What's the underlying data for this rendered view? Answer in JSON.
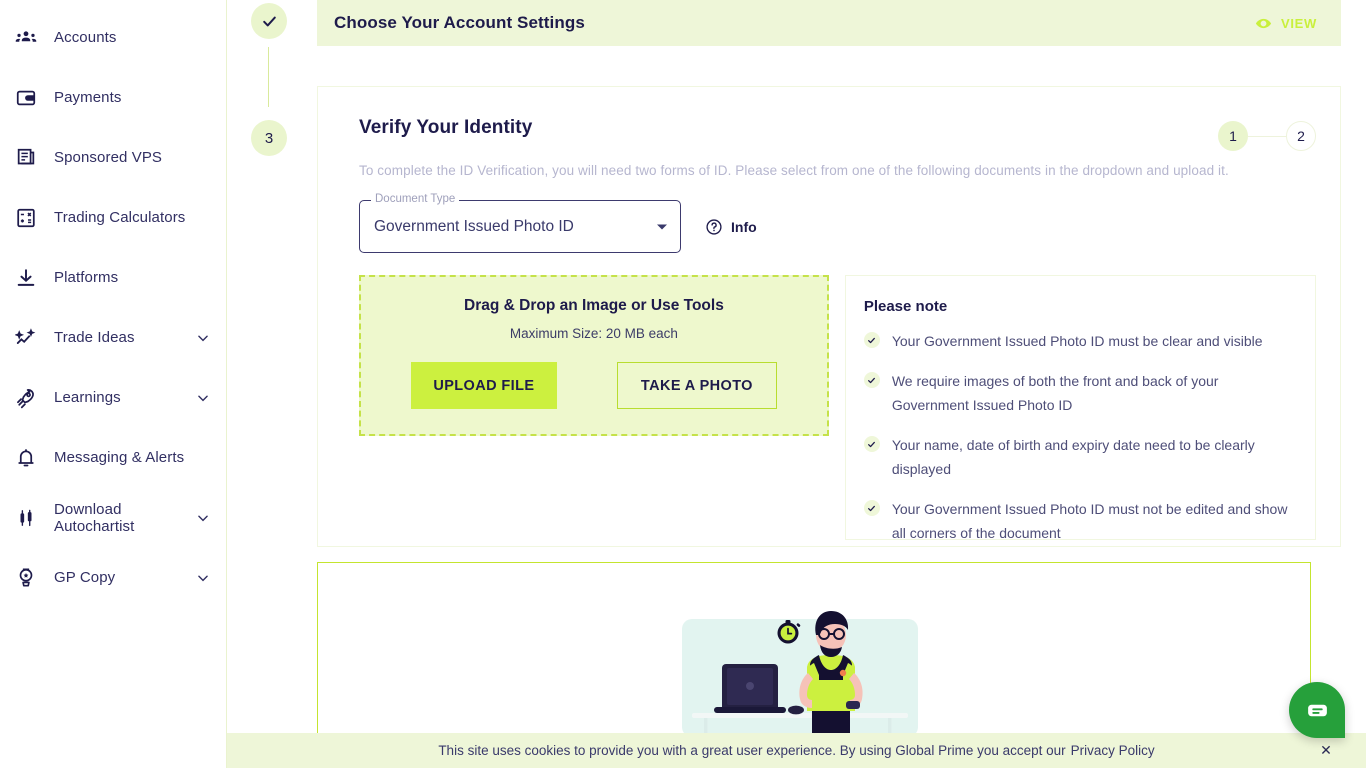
{
  "sidebar": {
    "items": [
      {
        "label": "Accounts",
        "icon": "people-icon",
        "chevron": false
      },
      {
        "label": "Payments",
        "icon": "wallet-icon",
        "chevron": false
      },
      {
        "label": "Sponsored VPS",
        "icon": "server-icon",
        "chevron": false
      },
      {
        "label": "Trading Calculators",
        "icon": "calculator-icon",
        "chevron": false
      },
      {
        "label": "Platforms",
        "icon": "download-icon",
        "chevron": false
      },
      {
        "label": "Trade Ideas",
        "icon": "sparkle-chart-icon",
        "chevron": true
      },
      {
        "label": "Learnings",
        "icon": "rocket-icon",
        "chevron": true
      },
      {
        "label": "Messaging & Alerts",
        "icon": "bell-icon",
        "chevron": false
      },
      {
        "label": "Download Autochartist",
        "icon": "candlestick-icon",
        "chevron": true
      },
      {
        "label": "GP Copy",
        "icon": "medal-icon",
        "chevron": true
      }
    ]
  },
  "stepper": {
    "completed_icon": "check-icon",
    "current_step": "3"
  },
  "account_band": {
    "title": "Choose Your Account Settings",
    "view_label": "VIEW",
    "view_icon": "eye-icon"
  },
  "verify": {
    "title": "Verify Your Identity",
    "subtitle": "To complete the ID Verification, you will need two forms of ID. Please select from one of the following documents in the dropdown and upload it.",
    "pager": {
      "current": "1",
      "next": "2"
    },
    "document_type": {
      "legend": "Document Type",
      "value": "Government Issued Photo ID",
      "caret_icon": "chevron-down-icon"
    },
    "info": {
      "label": "Info",
      "icon": "question-circle-icon"
    },
    "dropzone": {
      "title": "Drag & Drop an Image or Use Tools",
      "subtitle": "Maximum Size: 20 MB each",
      "upload_label": "UPLOAD FILE",
      "photo_label": "TAKE A PHOTO"
    },
    "note": {
      "title": "Please note",
      "items": [
        "Your Government Issued Photo ID must be clear and visible",
        "We require images of both the front and back of your Government Issued Photo ID",
        "Your name, date of birth and expiry date need to be clearly displayed",
        "Your Government Issued Photo ID must not be edited and show all corners of the document"
      ]
    }
  },
  "illustration": {
    "name": "person-at-desk-with-laptop-illustration"
  },
  "cookie": {
    "text": "This site uses cookies to provide you with a great user experience. By using Global Prime you accept our",
    "link": "Privacy Policy",
    "close_icon": "close-icon"
  },
  "chat": {
    "icon": "chat-bubble-icon"
  },
  "colors": {
    "accent_lime": "#ccf03f",
    "band_green": "#eef6d8",
    "dropzone_bg": "#eef8cd",
    "dropzone_border": "#c5e249",
    "ink": "#1e1b4b",
    "muted": "#b6b6cf",
    "chat_green": "#26a03b"
  }
}
